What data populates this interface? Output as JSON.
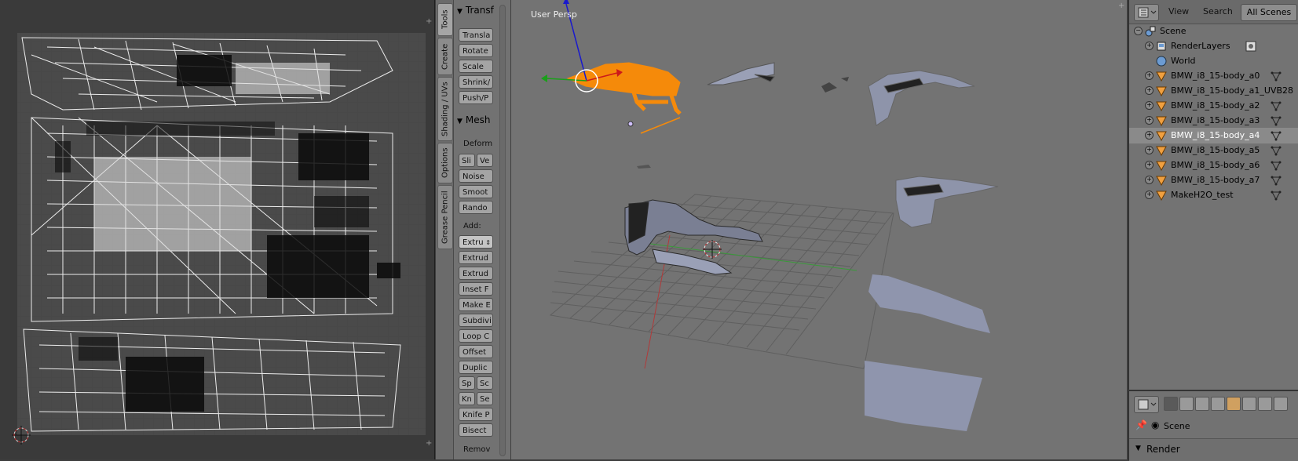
{
  "uv_editor": {},
  "tool_shelf": {
    "tabs": [
      "Tools",
      "Create",
      "Shading / UVs",
      "Options",
      "Grease Pencil"
    ],
    "transform": {
      "header": "Transf",
      "buttons": [
        "Transla",
        "Rotate",
        "Scale",
        "Shrink/",
        "Push/P"
      ]
    },
    "mesh": {
      "header": "Mesh",
      "deform_label": "Deform",
      "slide_left": "Sli",
      "slide_right": "Ve",
      "buttons": [
        "Noise",
        "Smoot",
        "Rando"
      ],
      "add_label": "Add:",
      "extrude_dropdown": "Extru",
      "add_buttons": [
        "Extrud",
        "Extrud",
        "Inset F",
        "Make E",
        "Subdivi",
        "Loop C",
        "Offset",
        "Duplic"
      ],
      "spin_left": "Sp",
      "spin_right": "Sc",
      "knife_left": "Kn",
      "knife_right": "Se",
      "knife_project": "Knife P",
      "bisect": "Bisect",
      "remove_label": "Remov"
    }
  },
  "viewport": {
    "label": "User Persp",
    "colors": {
      "selected": "#f58a0a",
      "mesh": "#8f95ad",
      "grid": "#5f5f5f",
      "x_axis": "#b03a3a",
      "y_axis": "#3a9a3a"
    }
  },
  "outliner": {
    "header": {
      "view": "View",
      "search": "Search",
      "scenes": "All Scenes"
    },
    "items": [
      {
        "label": "Scene",
        "icon": "scene-icon",
        "tail": ""
      },
      {
        "label": "RenderLayers",
        "icon": "render-layers-icon",
        "tail": "camera-icon"
      },
      {
        "label": "World",
        "icon": "world-icon",
        "tail": ""
      },
      {
        "label": "BMW_i8_15-body_a0",
        "icon": "mesh-object-icon",
        "tail": "mesh-data-icon"
      },
      {
        "label": "BMW_i8_15-body_a1_UVB28",
        "icon": "mesh-object-icon",
        "tail": ""
      },
      {
        "label": "BMW_i8_15-body_a2",
        "icon": "mesh-object-icon",
        "tail": "mesh-data-icon"
      },
      {
        "label": "BMW_i8_15-body_a3",
        "icon": "mesh-object-icon",
        "tail": "mesh-data-icon"
      },
      {
        "label": "BMW_i8_15-body_a4",
        "icon": "mesh-object-icon",
        "tail": "mesh-data-icon"
      },
      {
        "label": "BMW_i8_15-body_a5",
        "icon": "mesh-object-icon",
        "tail": "mesh-data-icon"
      },
      {
        "label": "BMW_i8_15-body_a6",
        "icon": "mesh-object-icon",
        "tail": "mesh-data-icon"
      },
      {
        "label": "BMW_i8_15-body_a7",
        "icon": "mesh-object-icon",
        "tail": "mesh-data-icon"
      },
      {
        "label": "MakeH2O_test",
        "icon": "mesh-object-icon",
        "tail": "mesh-data-icon"
      }
    ],
    "selected_index": 7
  },
  "properties": {
    "scene_label": "Scene",
    "panel_header": "Render"
  }
}
